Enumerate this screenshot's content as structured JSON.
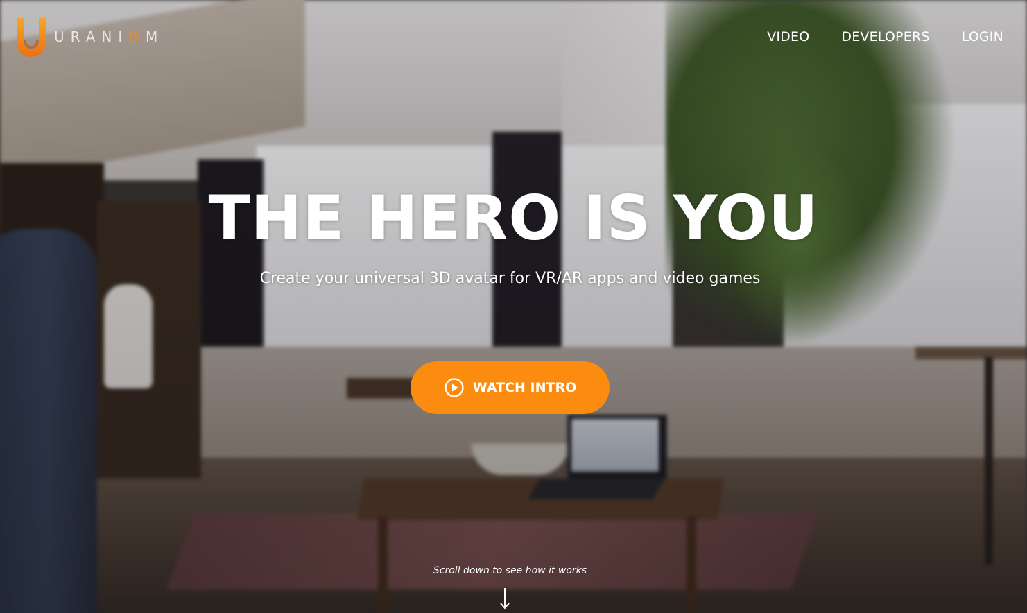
{
  "brand": {
    "name_prefix": "URANI",
    "name_accent": "O",
    "name_suffix": "M",
    "accent_color": "#f08a1c"
  },
  "nav": {
    "items": [
      {
        "label": "VIDEO"
      },
      {
        "label": "DEVELOPERS"
      },
      {
        "label": "LOGIN"
      }
    ]
  },
  "hero": {
    "title": "THE HERO IS YOU",
    "subtitle": "Create your universal 3D avatar for VR/AR apps and video games",
    "cta_label": "WATCH INTRO",
    "cta_icon": "play-circle-icon",
    "cta_color": "#fb8c0f",
    "scroll_hint": "Scroll down to see how it works",
    "scroll_icon": "arrow-down-icon"
  }
}
